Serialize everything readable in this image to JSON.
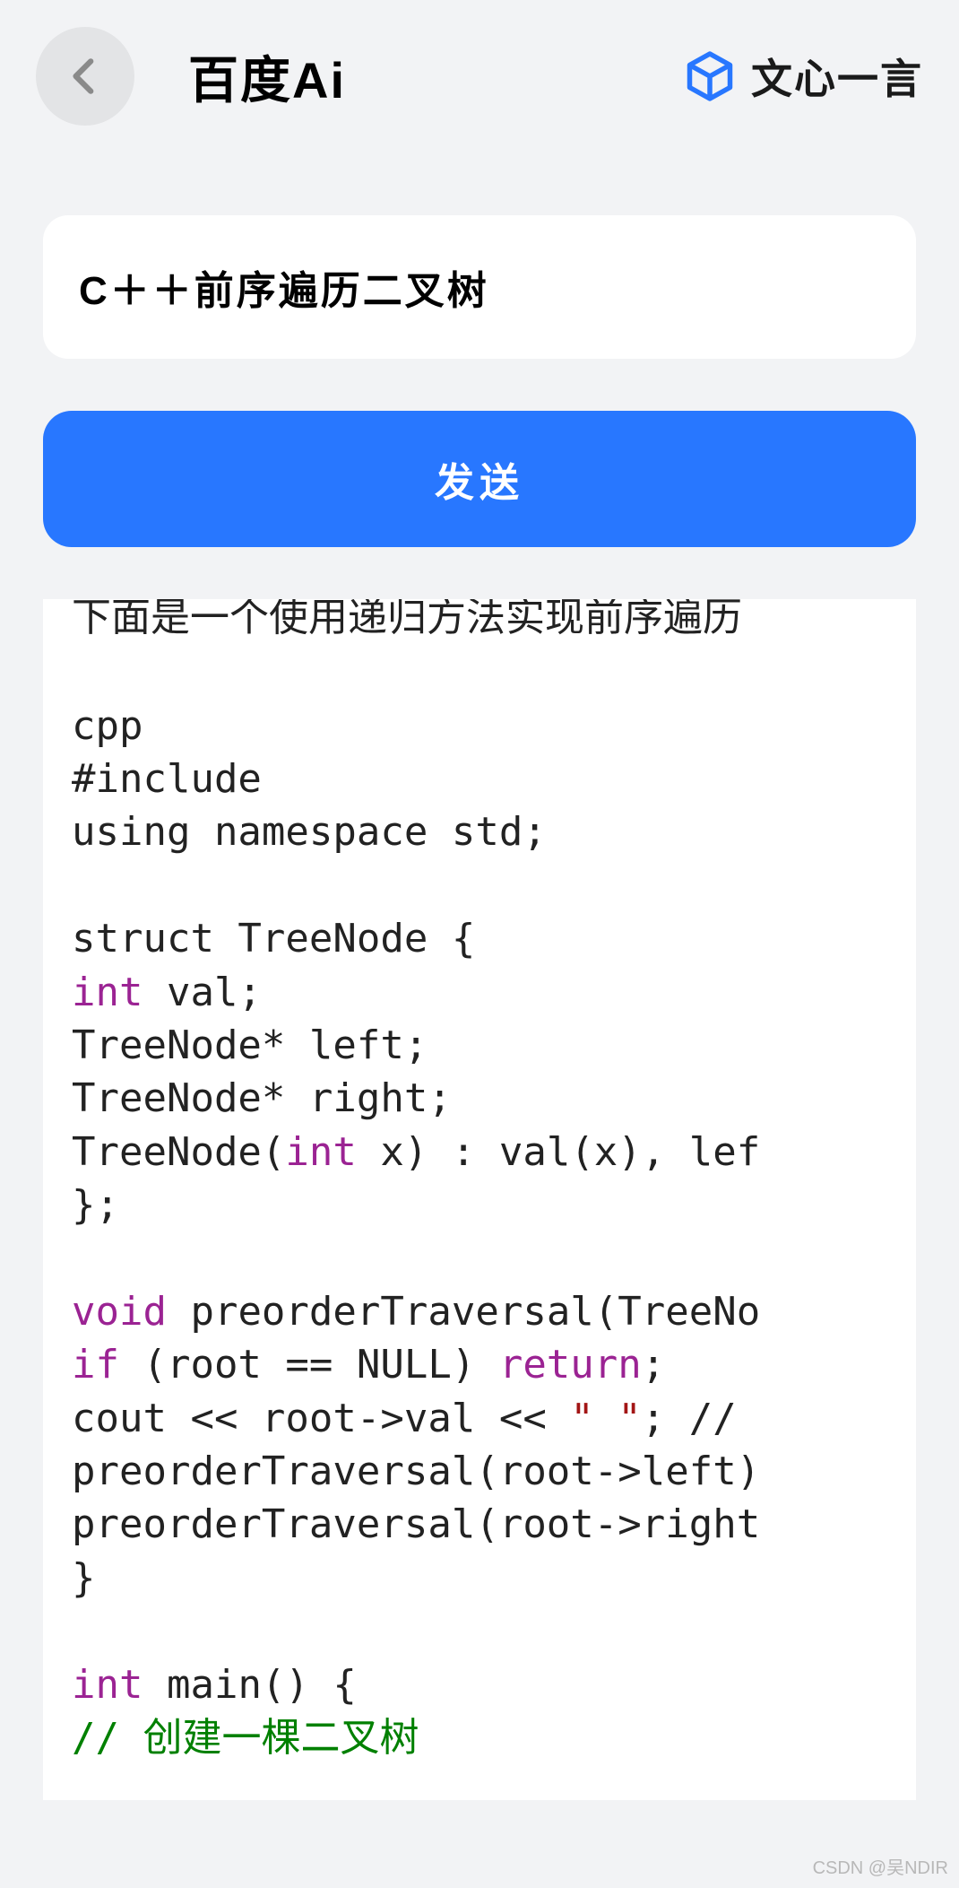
{
  "header": {
    "title": "百度Ai",
    "brand": "文心一言",
    "back_icon": "arrow-left"
  },
  "input": {
    "text": "C＋＋前序遍历二叉树"
  },
  "send_button": {
    "label": "发送"
  },
  "response": {
    "intro_partial": "下面是一个使用递归方法实现前序遍历",
    "code_lines": [
      {
        "t": "cpp"
      },
      {
        "t": "#include"
      },
      {
        "t": "using namespace std;"
      },
      {
        "t": ""
      },
      {
        "t": "struct TreeNode {"
      },
      {
        "kw": "int",
        "rest": " val;"
      },
      {
        "t": "TreeNode* left;"
      },
      {
        "t": "TreeNode* right;"
      },
      {
        "pre": "TreeNode(",
        "kw": "int",
        "rest": " x) : val(x), lef"
      },
      {
        "t": "};"
      },
      {
        "t": ""
      },
      {
        "kw": "void",
        "rest": " preorderTraversal(TreeNo"
      },
      {
        "kw": "if",
        "mid": " (root == NULL) ",
        "kw2": "return",
        "rest": ";"
      },
      {
        "pre": "cout << root->val << ",
        "str": "\" \"",
        "rest": "; //"
      },
      {
        "t": "preorderTraversal(root->left)"
      },
      {
        "t": "preorderTraversal(root->right"
      },
      {
        "t": "}"
      },
      {
        "t": ""
      },
      {
        "kw": "int",
        "rest": " main() {"
      },
      {
        "cm": "// 创建一棵二叉树"
      }
    ]
  },
  "watermark": "CSDN @吴NDIR",
  "colors": {
    "accent": "#2877ff",
    "brand_icon": "#2877ff",
    "keyword": "#9b2393"
  }
}
